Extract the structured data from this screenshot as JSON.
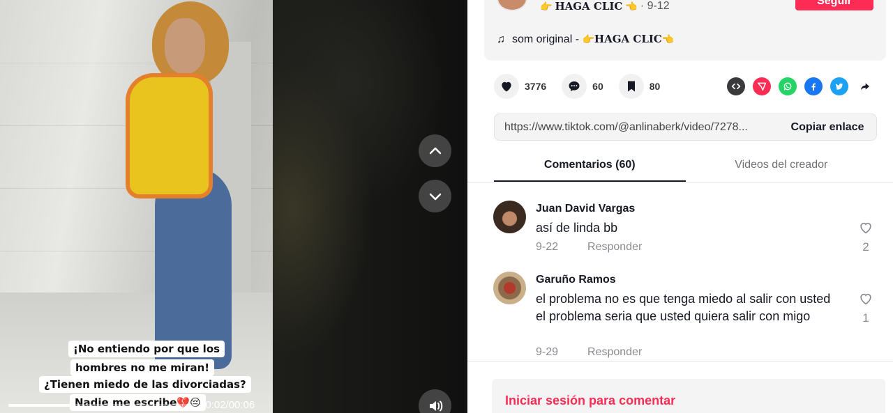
{
  "video": {
    "captions": [
      "¡No entiendo por que los",
      "hombres no me miran!",
      "¿Tienen miedo de las divorciadas?",
      "Nadie me escribe💔😔"
    ],
    "time": "00:02/00:06",
    "progress": 0.33
  },
  "author": {
    "name": "HAGA CLIC",
    "hand_left": "👉",
    "hand_right": "👈",
    "date": "· 9-12",
    "follow_label": "Seguir"
  },
  "music": {
    "text": "som original -",
    "author": "HAGA CLIC"
  },
  "actions": {
    "likes": "3776",
    "comments": "60",
    "saves": "80",
    "share_icons": [
      "embed-icon",
      "send-icon",
      "whatsapp-icon",
      "facebook-icon",
      "twitter-icon",
      "share-arrow-icon"
    ]
  },
  "link": {
    "url": "https://www.tiktok.com/@anlinaberk/video/7278...",
    "copy_label": "Copiar enlace"
  },
  "tabs": [
    {
      "label": "Comentarios (60)",
      "active": true
    },
    {
      "label": "Videos del creador",
      "active": false
    }
  ],
  "comments": [
    {
      "user": "Juan David Vargas",
      "text": "así de linda bb",
      "date": "9-22",
      "reply": "Responder",
      "likes": "2"
    },
    {
      "user": "Garuño Ramos",
      "text": "el problema no es que tenga miedo al salir con usted el problema seria que usted quiera salir con migo",
      "date": "9-29",
      "reply": "Responder",
      "likes": "1"
    }
  ],
  "login": {
    "label": "Iniciar sesión para comentar"
  },
  "colors": {
    "brand": "#fe2c55",
    "whatsapp": "#25d366",
    "facebook": "#1877f2",
    "twitter": "#1da1f2",
    "embed": "#3a3a3c",
    "send": "#fe2c55"
  }
}
